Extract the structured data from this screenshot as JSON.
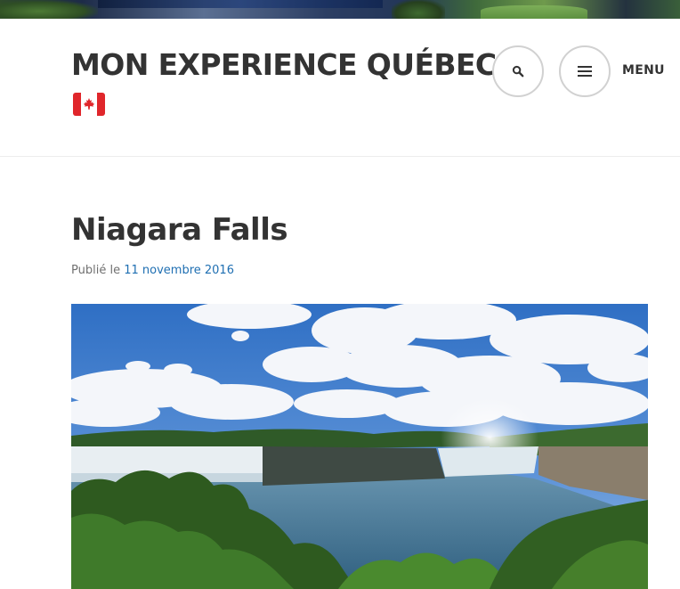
{
  "site": {
    "title": "MON EXPERIENCE QUÉBEC",
    "flag_icon": "canada-flag-icon",
    "flag_colors": {
      "red": "#e0262b",
      "white": "#ffffff"
    }
  },
  "header": {
    "search_icon": "search-icon",
    "menu_icon": "hamburger-menu-icon",
    "menu_label": "MENU"
  },
  "post": {
    "title": "Niagara Falls",
    "published_prefix": "Publié le",
    "published_date": "11 novembre 2016",
    "featured_image": "niagara-falls-photo"
  },
  "colors": {
    "text": "#333333",
    "link": "#1f6fb2",
    "meta": "#707070",
    "circle_border": "#d1d1d1"
  }
}
